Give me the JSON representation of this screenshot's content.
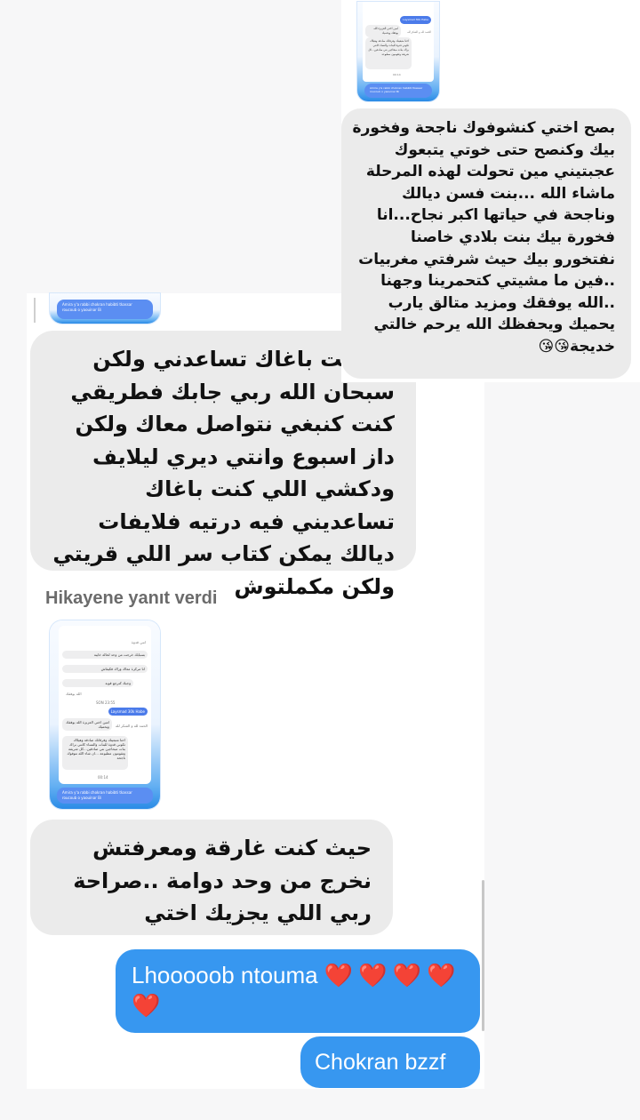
{
  "lower_panel": {
    "story_top_partial": {
      "footer": "Amira y'a rabbi chokran habibti tkassar roucoub o yaouinar Bi"
    },
    "message_1": "انا كنت  باغاك  تساعدني ولكن سبحان  الله  ربي جابك  فطريقي كنت كنبغي نتواصل معاك  ولكن  داز اسبوع  وانتي  ديري  ليلايف ودكشي اللي كنت  باغاك تساعديني فيه درتيه فلايفات  ديالك  يمكن  كتاب  سر اللي قريتي  ولكن  مكملتوش",
    "reply_label": "Hikayene yanıt verdi",
    "story_thumb": {
      "lines": [
        "انتي قدوة",
        "بسبابك خرجت من وحد لحالة خايبة",
        "انا مركزة معاك وراك فكيفاش",
        "وجبك كترجع قوية",
        "الله يوفقك"
      ],
      "timestamp": "SON 23:55",
      "blue_pill": "Laysmad 30k Habe",
      "reply_1": "امين اختي العزيزة الله يوفقك ويحميك",
      "reply_2": "الحمد لله و الشكر لله",
      "long_reply": "احنا متبعينك وفرقانك صادقة وهيلاك تكوني قدوة للبنات والنساء كانتي براك بنات مبحاجين نتي صادقين...كل شريفة وتقومون مطبوعة ...ان شاء الله نتوفوك ناجحة",
      "time2": "00:14",
      "footer": "Amira y'a rabbi chokran habibti tkassar roucoub o yaouinar Bi"
    },
    "message_2": "حيث كنت  غارقة ومعرفتش نخرج من وحد دوامة ..صراحة ربي اللي يجزيك اختي",
    "sent_1_text": "Lhooooob ntouma",
    "sent_1_hearts": "❤️❤️❤️❤️",
    "sent_1_heart_extra": "❤️",
    "sent_2": "Chokran bzzf"
  },
  "top_overlay": {
    "story_thumb": {
      "blue_pill": "Laysmad 30k Habe",
      "reply_1": "امين اختي العزيزة الله يوفقك ويحميك",
      "reply_2": "الحمد لله و الشكر لله",
      "long_reply": "احنا متبعينك وفرقانك صادقة وهيلاك تكوني قدوة للبنات والنساء كانتي براك بنات مبحاجين نتي صادقين...كل شريفة وتقومون مطبوعة",
      "time": "00:14",
      "footer": "Amira y'a rabbi chokran habibti tkassar roucoub o yaouinar Bi"
    },
    "message": "بصح اختي كنشوفوك ناجحة وفخورة بيك وكنصح حتى خوتي يتبعوك عجبتيني مين تحولت لهذه المرحلة ماشاء الله ...بنت  فسن ديالك وناجحة في  حياتها اكبر نجاح...انا فخورة بيك بنت بلادي خاصنا نفتخورو بيك  حيث  شرفتي مغربيات ..فين  ما مشيتي كتحمرينا وجهنا  ..الله يوفقك  ومزيد متالق يارب يحميك ويحفظك الله يرحم خالتي  خديجة😘😘"
  },
  "colors": {
    "bubble_gray": "#ebebeb",
    "bubble_blue": "#3797f0",
    "heart": "#e8262e",
    "reply_label": "#6b6b6b"
  }
}
